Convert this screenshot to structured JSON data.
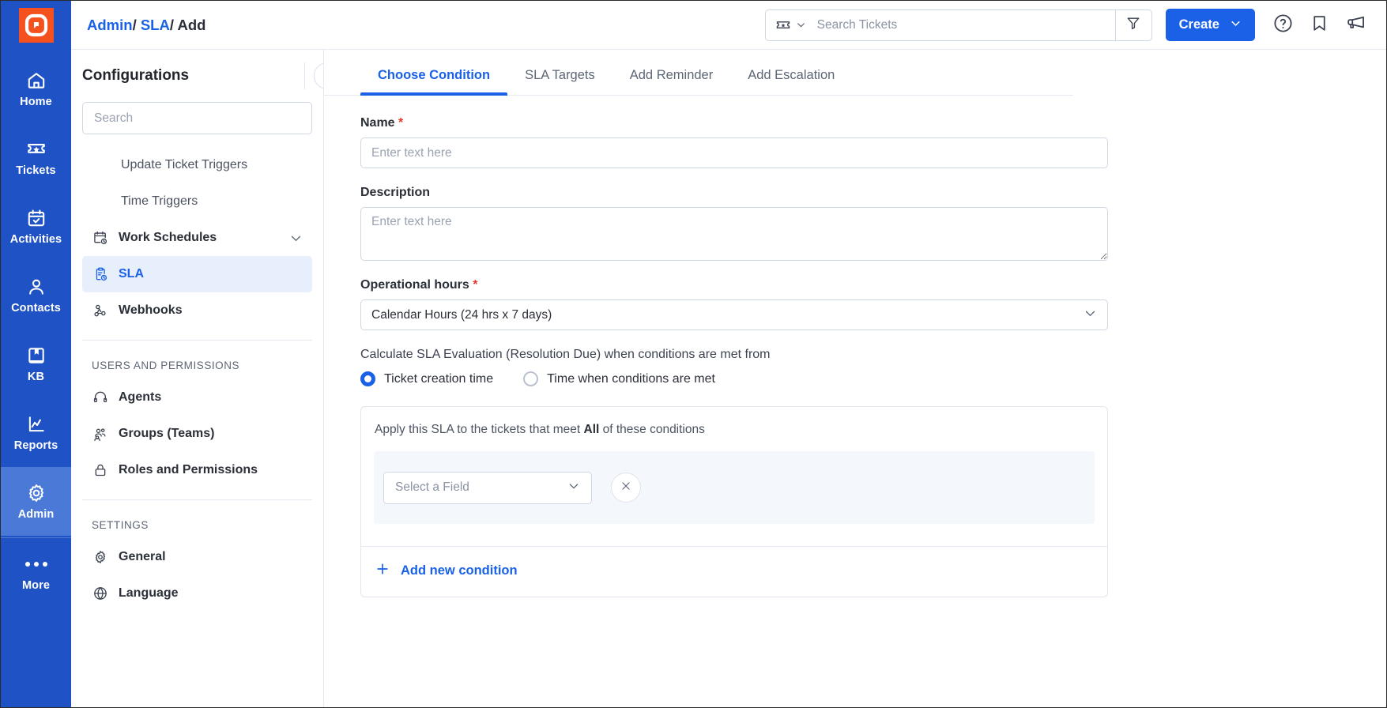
{
  "brand": {
    "logo_icon": "bitrix-logo-icon",
    "logo_bg": "#f4511e",
    "rail_bg": "#1f52c4",
    "accent": "#1a61e8",
    "required_color": "#e03b2f"
  },
  "rail": {
    "items": [
      {
        "label": "Home",
        "icon": "home-icon",
        "active": false
      },
      {
        "label": "Tickets",
        "icon": "ticket-icon",
        "active": false
      },
      {
        "label": "Activities",
        "icon": "calendar-check-icon",
        "active": false
      },
      {
        "label": "Contacts",
        "icon": "person-icon",
        "active": false
      },
      {
        "label": "KB",
        "icon": "book-icon",
        "active": false
      },
      {
        "label": "Reports",
        "icon": "chart-line-icon",
        "active": false
      },
      {
        "label": "Admin",
        "icon": "gear-icon",
        "active": true
      },
      {
        "label": "More",
        "icon": "ellipsis-icon",
        "active": false
      }
    ]
  },
  "topbar": {
    "breadcrumb": {
      "admin": "Admin",
      "sla": "SLA",
      "current": "Add",
      "separator": "/"
    },
    "search": {
      "placeholder": "Search Tickets",
      "value": "",
      "type_icon": "ticket-icon",
      "chevron": "chevron-down-icon"
    },
    "filter_icon": "filter-icon",
    "create_label": "Create",
    "create_chevron": "chevron-down-icon",
    "help_icon": "question-circle-icon",
    "bookmark_icon": "bookmark-icon",
    "announcement_icon": "megaphone-icon"
  },
  "config_panel": {
    "title": "Configurations",
    "collapse_icon": "chevron-left-icon",
    "search_placeholder": "Search",
    "search_value": "",
    "items": [
      {
        "label": "Update Ticket Triggers",
        "icon": null,
        "active": false,
        "chevron": false
      },
      {
        "label": "Time Triggers",
        "icon": null,
        "active": false,
        "chevron": false
      },
      {
        "label": "Work Schedules",
        "icon": "calendar-clock-icon",
        "active": false,
        "chevron": true
      },
      {
        "label": "SLA",
        "icon": "clipboard-clock-icon",
        "active": true,
        "chevron": false
      },
      {
        "label": "Webhooks",
        "icon": "webhook-icon",
        "active": false,
        "chevron": false
      }
    ],
    "sections": [
      {
        "heading": "USERS AND PERMISSIONS",
        "items": [
          {
            "label": "Agents",
            "icon": "headset-icon"
          },
          {
            "label": "Groups (Teams)",
            "icon": "users-icon"
          },
          {
            "label": "Roles and Permissions",
            "icon": "lock-icon"
          }
        ]
      },
      {
        "heading": "SETTINGS",
        "items": [
          {
            "label": "General",
            "icon": "gear-icon"
          },
          {
            "label": "Language",
            "icon": "globe-icon"
          }
        ]
      }
    ]
  },
  "main": {
    "tabs": [
      {
        "label": "Choose Condition",
        "active": true
      },
      {
        "label": "SLA Targets",
        "active": false
      },
      {
        "label": "Add Reminder",
        "active": false
      },
      {
        "label": "Add Escalation",
        "active": false
      }
    ],
    "name": {
      "label": "Name",
      "required": "*",
      "placeholder": "Enter text here",
      "value": ""
    },
    "description": {
      "label": "Description",
      "placeholder": "Enter text here",
      "value": ""
    },
    "operational_hours": {
      "label": "Operational hours",
      "required": "*",
      "selected": "Calendar Hours (24 hrs x 7 days)",
      "chevron": "chevron-down-icon"
    },
    "calculate": {
      "label": "Calculate SLA Evaluation (Resolution Due) when conditions are met from",
      "options": [
        {
          "label": "Ticket creation time",
          "checked": true
        },
        {
          "label": "Time when conditions are met",
          "checked": false
        }
      ]
    },
    "conditions": {
      "intro_prefix": "Apply this SLA to the tickets that meet ",
      "intro_bold": "All",
      "intro_suffix": " of these conditions",
      "rows": [
        {
          "field_placeholder": "Select a Field",
          "chevron": "chevron-down-icon",
          "remove_icon": "close-icon"
        }
      ],
      "add_label": "Add new condition",
      "add_icon": "plus-icon"
    }
  }
}
